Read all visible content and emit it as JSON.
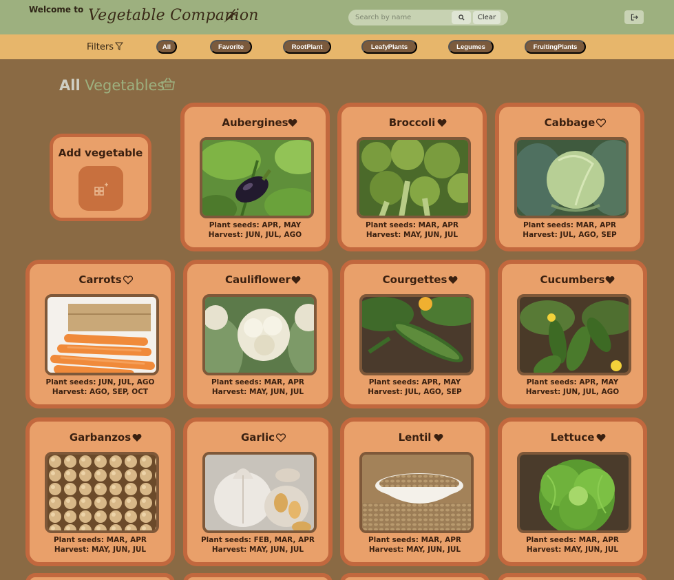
{
  "header": {
    "welcome": "Welcome to",
    "brand": "Vegetable Companion",
    "search_placeholder": "Search by name",
    "clear_label": "Clear"
  },
  "filters": {
    "label": "Filters",
    "chips": [
      "All",
      "Favorite",
      "RootPlant",
      "LeafyPlants",
      "Legumes",
      "FruitingPlants"
    ]
  },
  "section": {
    "title_bold": "All",
    "title_rest": "Vegetables"
  },
  "add_card": {
    "label": "Add vegetable"
  },
  "vegetables": [
    {
      "name": "Aubergines",
      "favorite": true,
      "seeds": "Plant seeds: APR, MAY",
      "harvest": "Harvest: JUN, JUL, AGO"
    },
    {
      "name": "Broccoli",
      "favorite": true,
      "seeds": "Plant seeds: MAR, APR",
      "harvest": "Harvest: MAY, JUN, JUL"
    },
    {
      "name": "Cabbage",
      "favorite": false,
      "seeds": "Plant seeds: MAR, APR",
      "harvest": "Harvest: JUL, AGO, SEP"
    },
    {
      "name": "Carrots",
      "favorite": false,
      "seeds": "Plant seeds: JUN, JUL, AGO",
      "harvest": "Harvest: AGO, SEP, OCT"
    },
    {
      "name": "Cauliflower",
      "favorite": true,
      "seeds": "Plant seeds: MAR, APR",
      "harvest": "Harvest: MAY, JUN, JUL"
    },
    {
      "name": "Courgettes",
      "favorite": true,
      "seeds": "Plant seeds: APR, MAY",
      "harvest": "Harvest: JUL, AGO, SEP"
    },
    {
      "name": "Cucumbers",
      "favorite": true,
      "seeds": "Plant seeds: APR, MAY",
      "harvest": "Harvest: JUN, JUL, AGO"
    },
    {
      "name": "Garbanzos",
      "favorite": true,
      "seeds": "Plant seeds: MAR, APR",
      "harvest": "Harvest: MAY, JUN, JUL"
    },
    {
      "name": "Garlic",
      "favorite": false,
      "seeds": "Plant seeds: FEB, MAR, APR",
      "harvest": "Harvest: MAY, JUN, JUL"
    },
    {
      "name": "Lentil",
      "favorite": true,
      "seeds": "Plant seeds: MAR, APR",
      "harvest": "Harvest: MAY, JUN, JUL"
    },
    {
      "name": "Lettuce",
      "favorite": true,
      "seeds": "Plant seeds: MAR, APR",
      "harvest": "Harvest: MAY, JUN, JUL"
    }
  ],
  "colors": {
    "header_bg": "#9db07f",
    "filterbar_bg": "#e7b66b",
    "page_bg": "#8a6a44",
    "card_bg": "#e9a06a",
    "card_border": "#c2683e",
    "chip_bg": "#7b5a3c"
  }
}
